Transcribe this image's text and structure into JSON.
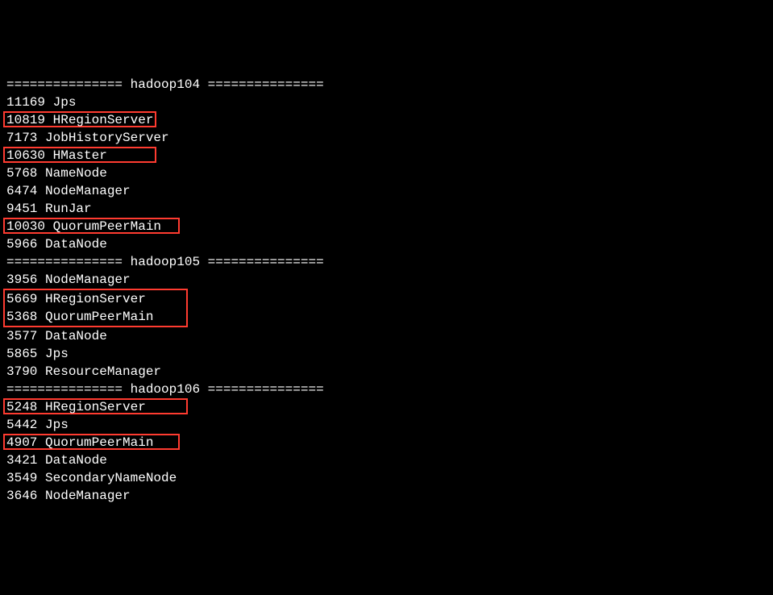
{
  "hosts": [
    {
      "header": "=============== hadoop104 ===============",
      "lines": [
        {
          "pid": "11169",
          "name": "Jps",
          "hl": false
        },
        {
          "pid": "10819",
          "name": "HRegionServer",
          "hl": true,
          "pad": "10819 HRegionServer"
        },
        {
          "pid": "7173",
          "name": "JobHistoryServer",
          "hl": false
        },
        {
          "pid": "10630",
          "name": "HMaster",
          "hl": true,
          "pad": "10630 HMaster      "
        },
        {
          "pid": "5768",
          "name": "NameNode",
          "hl": false
        },
        {
          "pid": "6474",
          "name": "NodeManager",
          "hl": false
        },
        {
          "pid": "9451",
          "name": "RunJar",
          "hl": false
        },
        {
          "pid": "10030",
          "name": "QuorumPeerMain",
          "hl": true,
          "pad": "10030 QuorumPeerMain  "
        },
        {
          "pid": "5966",
          "name": "DataNode",
          "hl": false
        }
      ]
    },
    {
      "header": "=============== hadoop105 ===============",
      "lines": [
        {
          "pid": "3956",
          "name": "NodeManager",
          "hl": false
        },
        {
          "pid": "5669",
          "name": "HRegionServer",
          "hl": true,
          "group": 1,
          "pad": "5669 HRegionServer     "
        },
        {
          "pid": "5368",
          "name": "QuorumPeerMain",
          "hl": true,
          "group": 1,
          "pad": "5368 QuorumPeerMain    "
        },
        {
          "pid": "3577",
          "name": "DataNode",
          "hl": false
        },
        {
          "pid": "5865",
          "name": "Jps",
          "hl": false
        },
        {
          "pid": "3790",
          "name": "ResourceManager",
          "hl": false
        }
      ]
    },
    {
      "header": "=============== hadoop106 ===============",
      "lines": [
        {
          "pid": "5248",
          "name": "HRegionServer",
          "hl": true,
          "pad": "5248 HRegionServer     "
        },
        {
          "pid": "5442",
          "name": "Jps",
          "hl": false
        },
        {
          "pid": "4907",
          "name": "QuorumPeerMain",
          "hl": true,
          "pad": "4907 QuorumPeerMain   "
        },
        {
          "pid": "3421",
          "name": "DataNode",
          "hl": false
        },
        {
          "pid": "3549",
          "name": "SecondaryNameNode",
          "hl": false
        },
        {
          "pid": "3646",
          "name": "NodeManager",
          "hl": false
        }
      ]
    }
  ]
}
